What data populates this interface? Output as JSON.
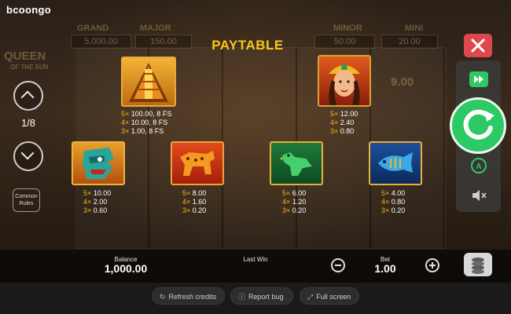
{
  "brand": {
    "logo_text": "bcoongo"
  },
  "background": {
    "jackpots": [
      {
        "label": "GRAND",
        "value": "5,000.00"
      },
      {
        "label": "MAJOR",
        "value": "150.00"
      },
      {
        "label": "MINOR",
        "value": "50.00"
      },
      {
        "label": "MINI",
        "value": "20.00"
      }
    ],
    "game_title_line1": "QUEEN",
    "game_title_line2": "OF THE SUN",
    "ghost_value": "9.00"
  },
  "paytable": {
    "title": "PAYTABLE",
    "page_indicator": "1/8",
    "common_rules_label": "Common Rules",
    "symbols": [
      {
        "name": "pyramid",
        "pays": [
          {
            "k": "5×",
            "v": "100.00, 8 FS"
          },
          {
            "k": "4×",
            "v": "10.00, 8 FS"
          },
          {
            "k": "3×",
            "v": "1.00, 8 FS"
          }
        ]
      },
      {
        "name": "queen",
        "pays": [
          {
            "k": "5×",
            "v": "12.00"
          },
          {
            "k": "4×",
            "v": "2.40"
          },
          {
            "k": "3×",
            "v": "0.80"
          }
        ]
      },
      {
        "name": "warrior-mask",
        "pays": [
          {
            "k": "5×",
            "v": "10.00"
          },
          {
            "k": "4×",
            "v": "2.00"
          },
          {
            "k": "3×",
            "v": "0.60"
          }
        ]
      },
      {
        "name": "jaguar",
        "pays": [
          {
            "k": "5×",
            "v": "8.00"
          },
          {
            "k": "4×",
            "v": "1.60"
          },
          {
            "k": "3×",
            "v": "0.20"
          }
        ]
      },
      {
        "name": "bird",
        "pays": [
          {
            "k": "5×",
            "v": "6.00"
          },
          {
            "k": "4×",
            "v": "1.20"
          },
          {
            "k": "3×",
            "v": "0.20"
          }
        ]
      },
      {
        "name": "fish",
        "pays": [
          {
            "k": "5×",
            "v": "4.00"
          },
          {
            "k": "4×",
            "v": "0.80"
          },
          {
            "k": "3×",
            "v": "0.20"
          }
        ]
      }
    ]
  },
  "bottom_bar": {
    "balance_label": "Balance",
    "balance_value": "1,000.00",
    "last_win_label": "Last Win",
    "bet_label": "Bet",
    "bet_value": "1.00"
  },
  "footer": {
    "refresh_label": "Refresh credits",
    "report_label": "Report bug",
    "fullscreen_label": "Full screen"
  },
  "colors": {
    "accent_yellow": "#f6c81c",
    "spin_green": "#2cc964",
    "close_red": "#e0474c"
  }
}
